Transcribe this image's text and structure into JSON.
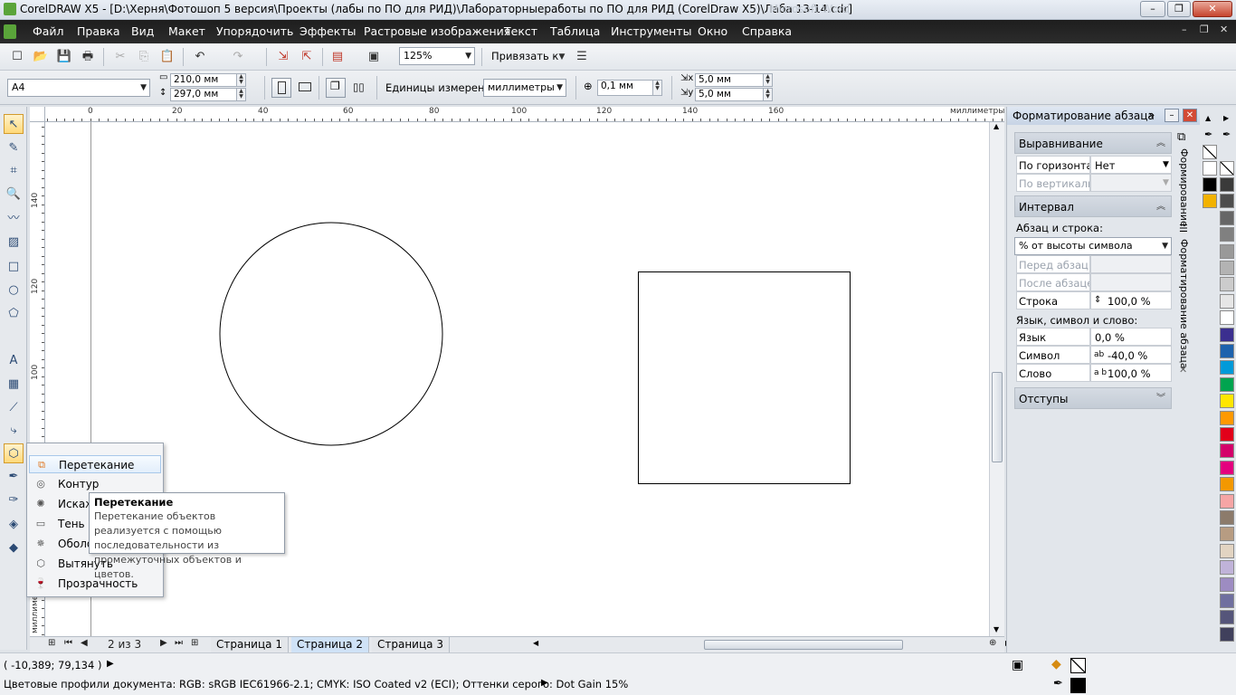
{
  "window": {
    "title": "CorelDRAW X5 - [D:\\Херня\\Фотошоп 5 версия\\Проекты (лабы по ПО для РИД)\\Лабораторныеработы по ПО для РИД (CorelDraw X5)\\Лаба 13-14.cdr]",
    "ghost_title": "Microsoft Word",
    "minimize": "–",
    "maximize": "❐",
    "close": "✕"
  },
  "menu": {
    "items": [
      "Файл",
      "Правка",
      "Вид",
      "Макет",
      "Упорядочить",
      "Эффекты",
      "Растровые изображения",
      "Текст",
      "Таблица",
      "Инструменты",
      "Окно",
      "Справка"
    ],
    "doc_minimize": "–",
    "doc_restore": "❐",
    "doc_close": "✕"
  },
  "standard_toolbar": {
    "zoom_value": "125%",
    "snap_label": "Привязать к"
  },
  "property_bar": {
    "page_size": "A4",
    "width": "210,0 мм",
    "height": "297,0 мм",
    "units_label": "Единицы измерения:",
    "units_value": "миллиметры",
    "nudge": "0,1 мм",
    "dup_x": "5,0 мм",
    "dup_y": "5,0 мм"
  },
  "rulers": {
    "unit_label": "миллиметры",
    "h_labels": [
      "0",
      "20",
      "40",
      "60",
      "80",
      "100",
      "120",
      "140",
      "160"
    ],
    "v_labels": [
      "140",
      "120",
      "100"
    ],
    "v_unit_label": "миллиметры"
  },
  "flyout": {
    "items": [
      {
        "label": "Перетекание",
        "icon": "blend-icon"
      },
      {
        "label": "Контур",
        "icon": "contour-icon"
      },
      {
        "label": "Искажение",
        "icon": "distort-icon"
      },
      {
        "label": "Тень",
        "icon": "shadow-icon"
      },
      {
        "label": "Оболочка",
        "icon": "envelope-icon"
      },
      {
        "label": "Вытянуть",
        "icon": "extrude-icon"
      },
      {
        "label": "Прозрачность",
        "icon": "transparency-icon"
      }
    ]
  },
  "tooltip": {
    "title": "Перетекание",
    "body": "Перетекание объектов реализуется с помощью последовательности из промежуточных объектов и цветов."
  },
  "page_bar": {
    "page_counter": "2 из 3",
    "tabs": [
      "Страница 1",
      "Страница 2",
      "Страница 3"
    ],
    "active_tab": "Страница 2"
  },
  "status": {
    "coords": "( -10,389; 79,134 )",
    "profile": "Цветовые профили документа: RGB: sRGB IEC61966-2.1; CMYK: ISO Coated v2 (ECI); Оттенки серого: Dot Gain 15%"
  },
  "docker": {
    "title": "Форматирование абзаца",
    "alignment": {
      "header": "Выравнивание",
      "horizontal_label": "По горизонтали",
      "horizontal_value": "Нет",
      "vertical_label": "По вертикали",
      "vertical_value": ""
    },
    "spacing": {
      "header": "Интервал",
      "para_line_label": "Абзац и строка:",
      "mode_value": "% от высоты символа",
      "before_label": "Перед абзац...",
      "after_label": "После абзацев",
      "line_label": "Строка",
      "line_value": "100,0 %",
      "lang_char_word_label": "Язык, символ и слово:",
      "lang_label": "Язык",
      "lang_value": "0,0 %",
      "char_label": "Символ",
      "char_value": "-40,0 %",
      "word_label": "Слово",
      "word_value": "100,0 %"
    },
    "indents_header": "Отступы",
    "side_tabs": [
      "Формирование",
      "Форматирование абзаца"
    ]
  },
  "palette": {
    "colors": [
      "#ffffff",
      "#000000",
      "#f2b200",
      "#3a3a3a",
      "#4d4d4d",
      "#666666",
      "#808080",
      "#999999",
      "#b3b3b3",
      "#cccccc",
      "#e6e6e6",
      "#ffffff",
      "#3b2f8f",
      "#1d62ad",
      "#009ad9",
      "#00a44f",
      "#ffe600",
      "#ff9900",
      "#e2001a",
      "#d4006a",
      "#e4007e",
      "#f39800",
      "#f6a5a5",
      "#8c7b6b",
      "#b79c82",
      "#e2d4c2",
      "#c0b3d9",
      "#9d8cc2",
      "#6f6f9f",
      "#55557a",
      "#40405c",
      "#303045"
    ]
  }
}
